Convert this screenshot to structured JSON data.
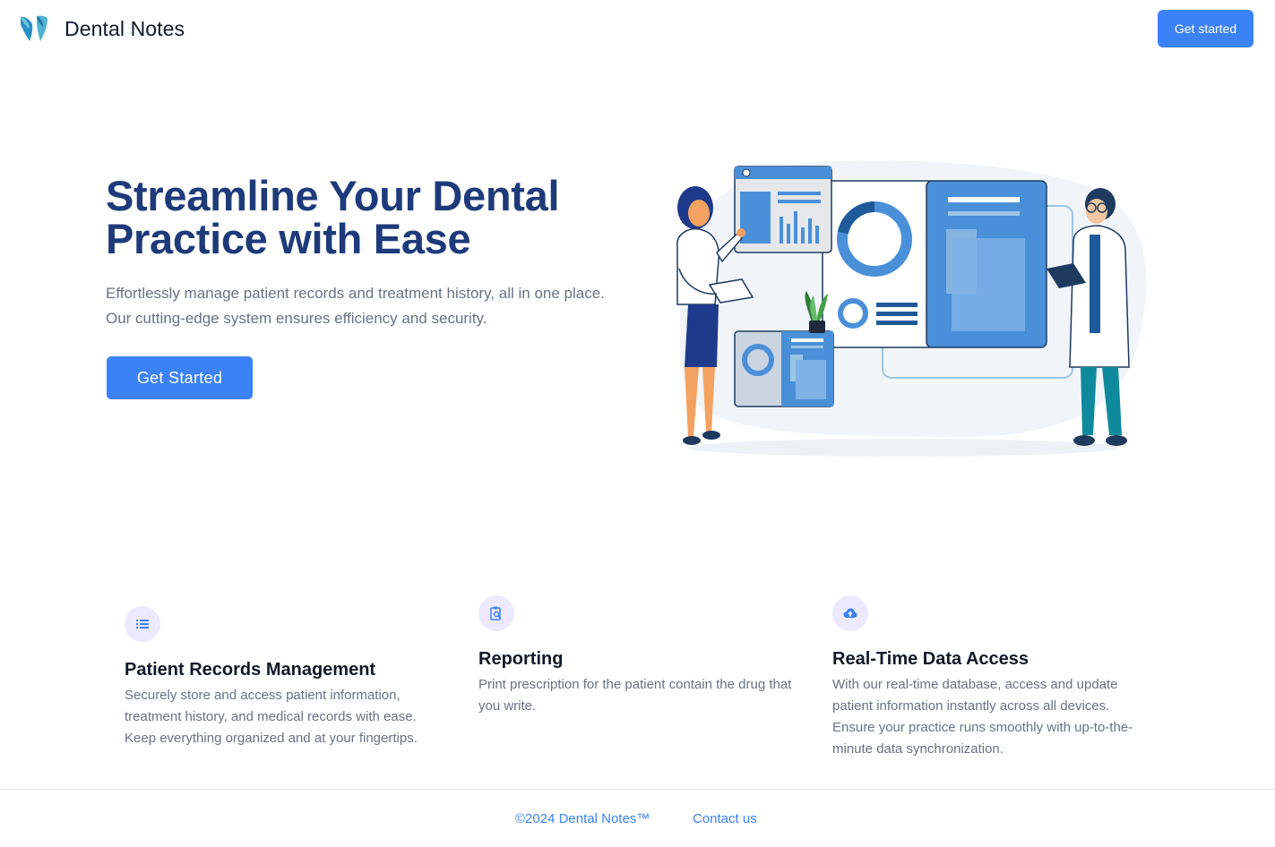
{
  "header": {
    "brand": "Dental Notes",
    "cta_label": "Get started",
    "logo_icon": "tooth-logo-icon"
  },
  "hero": {
    "title": "Streamline Your Dental Practice with Ease",
    "subtitle": "Effortlessly manage patient records and treatment history, all in one place. Our cutting-edge system ensures efficiency and security.",
    "cta_label": "Get Started",
    "illustration": "doctors-dashboard-illustration"
  },
  "features": [
    {
      "icon": "list-icon",
      "title": "Patient Records Management",
      "description": "Securely store and access patient information, treatment history, and medical records with ease. Keep everything organized and at your fingertips."
    },
    {
      "icon": "clipboard-search-icon",
      "title": "Reporting",
      "description": "Print prescription for the patient contain the drug that you write."
    },
    {
      "icon": "cloud-upload-icon",
      "title": "Real-Time Data Access",
      "description": "With our real-time database, access and update patient information instantly across all devices. Ensure your practice runs smoothly with up-to-the-minute data synchronization."
    }
  ],
  "footer": {
    "copyright": "©2024 Dental Notes™",
    "contact_label": "Contact us"
  },
  "colors": {
    "primary": "#3b82f6",
    "title": "#1e3a7a",
    "muted_text": "#6b7280",
    "icon_bg": "#ede9fe"
  }
}
